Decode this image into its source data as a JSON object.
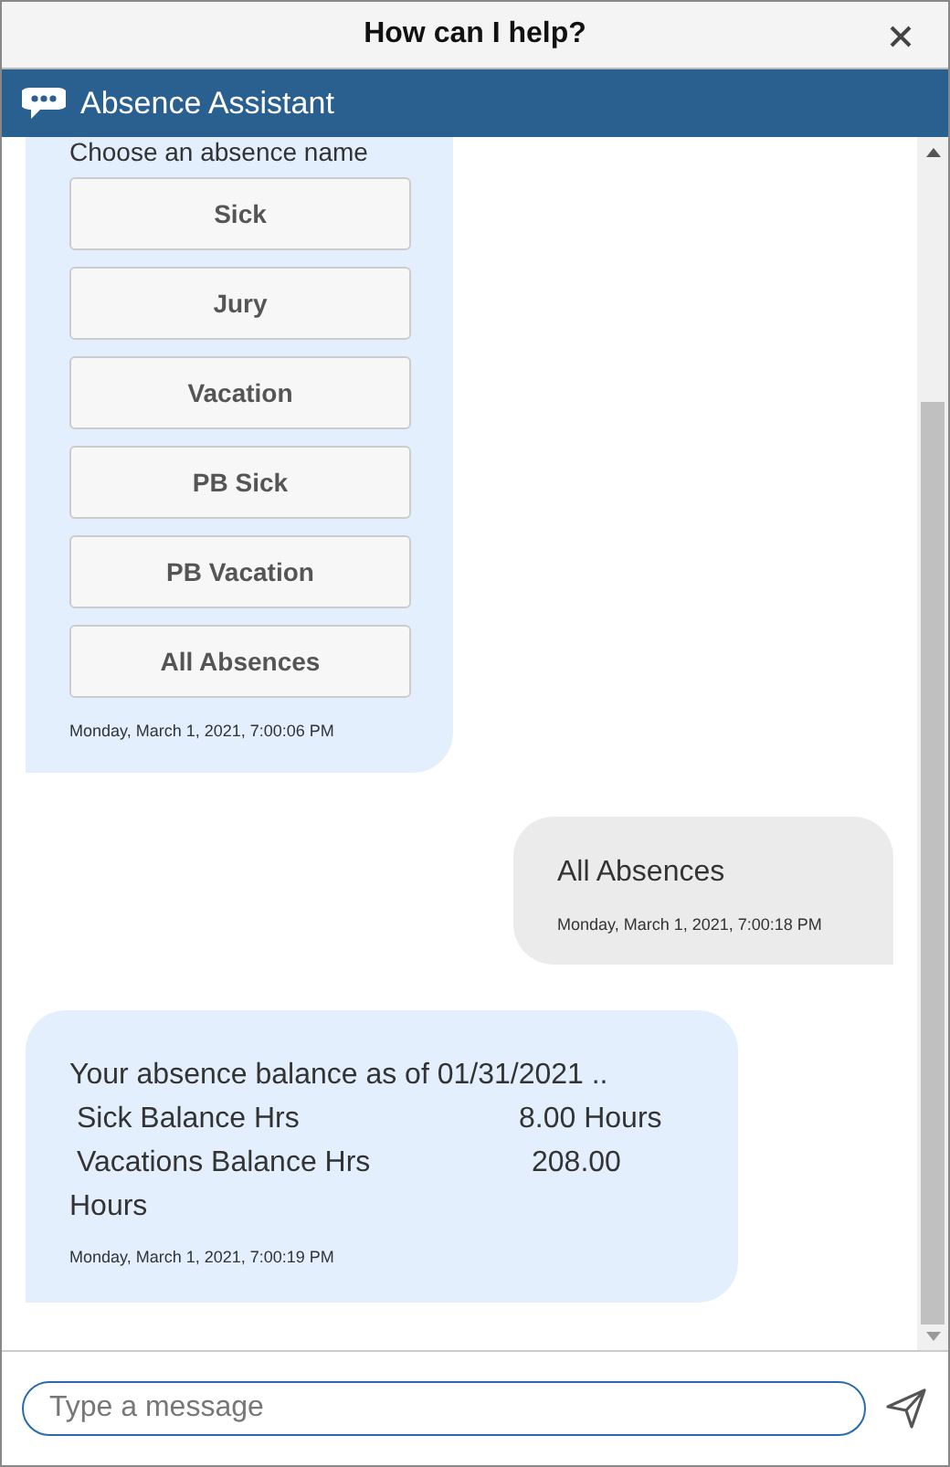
{
  "window": {
    "title": "How can I help?"
  },
  "header": {
    "title": "Absence Assistant"
  },
  "messages": [
    {
      "kind": "choices",
      "prompt": "Choose an absence name",
      "options": [
        "Sick",
        "Jury",
        "Vacation",
        "PB Sick",
        "PB Vacation",
        "All Absences"
      ],
      "time": "Monday, March 1, 2021, 7:00:06 PM"
    },
    {
      "kind": "user",
      "text": "All Absences",
      "time": "Monday, March 1, 2021, 7:00:18 PM"
    },
    {
      "kind": "balance",
      "intro": "Your absence balance as of 01/31/2021  ..",
      "rows": [
        {
          "label": "Sick Balance Hrs",
          "value": "8.00  Hours"
        },
        {
          "label": "Vacations Balance Hrs",
          "value": "208.00"
        }
      ],
      "tail": "Hours",
      "time": "Monday, March 1, 2021, 7:00:19 PM"
    }
  ],
  "composer": {
    "placeholder": "Type a message"
  }
}
